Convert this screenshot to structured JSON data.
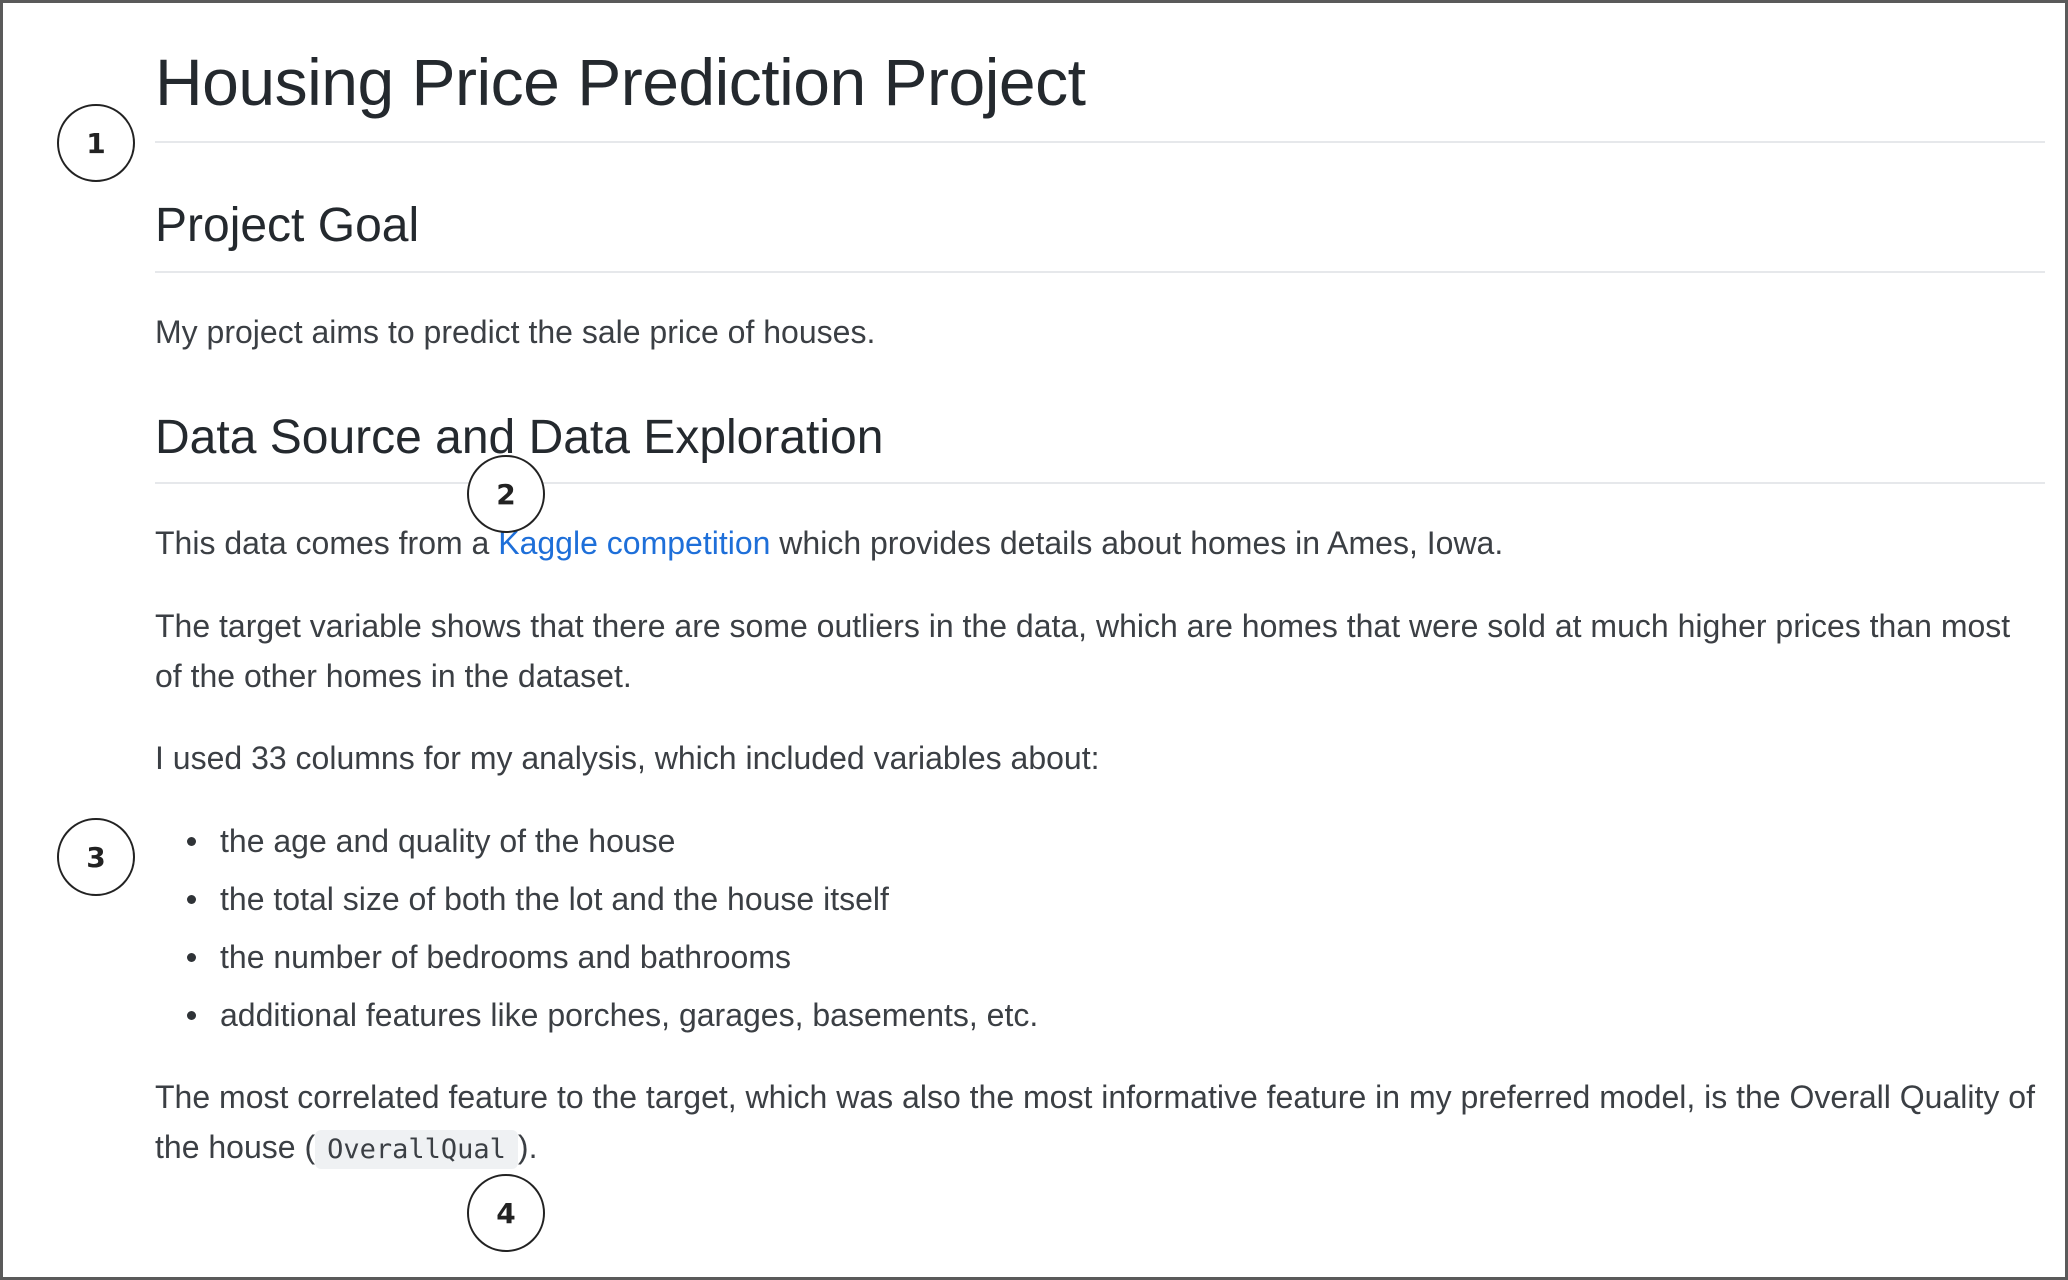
{
  "readme": {
    "title": "Housing Price Prediction Project",
    "goal_heading": "Project Goal",
    "goal_text": "My project aims to predict the sale price of houses.",
    "data_heading": "Data Source and Data Exploration",
    "source_pre": "This data comes from a ",
    "source_link": "Kaggle competition",
    "source_post": " which provides details about homes in Ames, Iowa.",
    "target_text": "The target variable shows that there are some outliers in the data, which are homes that were sold at much higher prices than most of the other homes in the dataset.",
    "columns_text": "I used 33 columns for my analysis, which included variables about:",
    "features": [
      "the age and quality of the house",
      "the total size of both the lot and the house itself",
      "the number of bedrooms and bathrooms",
      "additional features like porches, garages, basements, etc."
    ],
    "correlated_pre": "The most correlated feature to the target, which was also the most informative feature in my preferred model, is the Overall Quality of the house (",
    "correlated_code": "OverallQual",
    "correlated_post": ")."
  },
  "callouts": [
    "1",
    "2",
    "3",
    "4"
  ]
}
